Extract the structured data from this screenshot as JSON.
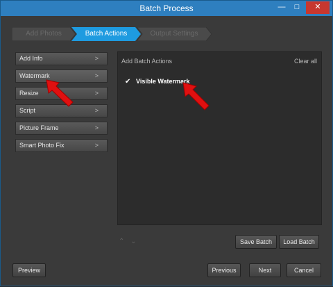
{
  "window": {
    "title": "Batch Process",
    "min_glyph": "—",
    "max_glyph": "□",
    "close_glyph": "✕"
  },
  "steps": [
    {
      "label": "Add Photos"
    },
    {
      "label": "Batch Actions"
    },
    {
      "label": "Output Settings"
    }
  ],
  "sidebar": {
    "items": [
      {
        "label": "Add Info",
        "chevron": ">"
      },
      {
        "label": "Watermark",
        "chevron": ">"
      },
      {
        "label": "Resize",
        "chevron": ">"
      },
      {
        "label": "Script",
        "chevron": ">"
      },
      {
        "label": "Picture Frame",
        "chevron": ">"
      },
      {
        "label": "Smart Photo Fix",
        "chevron": ">"
      }
    ]
  },
  "actions_panel": {
    "heading": "Add Batch Actions",
    "clear_all": "Clear all",
    "items": [
      {
        "label": "Visible Watermark",
        "check": "✔"
      }
    ],
    "move_up": "⌃",
    "move_down": "⌄"
  },
  "buttons": {
    "save_batch": "Save Batch",
    "load_batch": "Load Batch",
    "preview": "Preview",
    "previous": "Previous",
    "next": "Next",
    "cancel": "Cancel"
  },
  "colors": {
    "titlebar": "#2e7fbf",
    "active_step": "#1e9be0",
    "close_button": "#c7372f",
    "annotation_arrow": "#e01010"
  },
  "annotations": [
    {
      "icon": "red-arrow-icon",
      "target": "Watermark"
    },
    {
      "icon": "red-arrow-icon",
      "target": "Visible Watermark"
    }
  ]
}
